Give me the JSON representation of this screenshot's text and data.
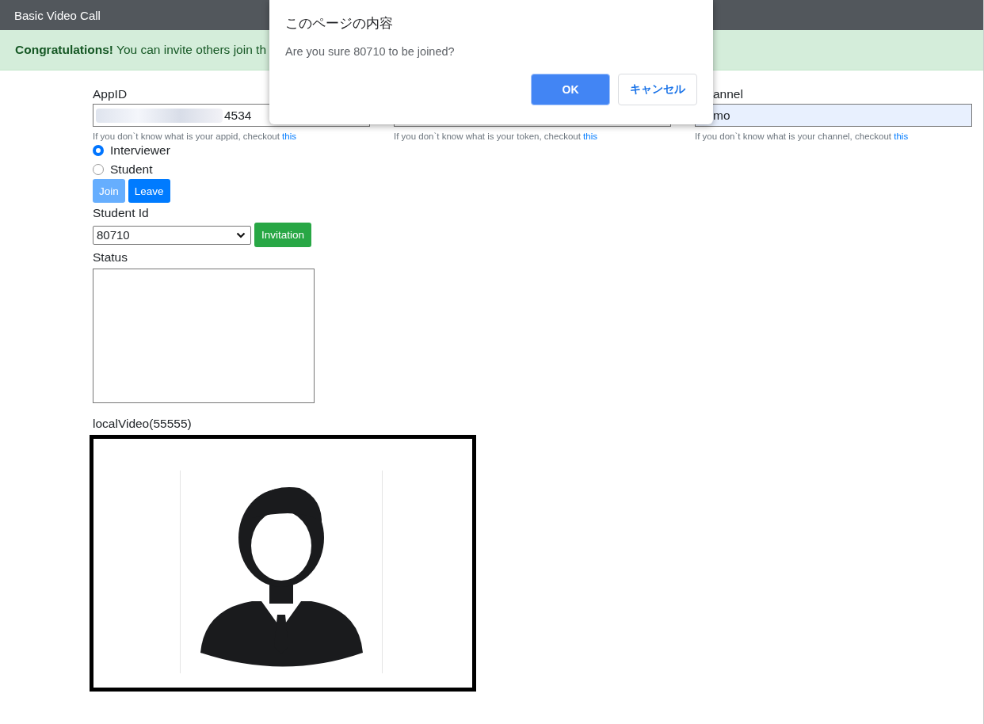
{
  "navbar": {
    "title": "Basic Video Call"
  },
  "alert": {
    "text": "**Congratulations!** You can invite others join th"
  },
  "fields": [
    {
      "label": "AppID",
      "value": "4534",
      "blurred": true,
      "hint": "If you don`t know what is your appid, checkout",
      "link": "this"
    },
    {
      "hint": "If you don`t know what is your token, checkout",
      "link": "this"
    },
    {
      "label": "annel",
      "value": "mo",
      "autofilled": true,
      "hint": "If you don`t know what is your channel, checkout",
      "link": "this"
    }
  ],
  "roles": [
    {
      "label": "Interviewer",
      "selected": true
    },
    {
      "label": "Student",
      "selected": false
    }
  ],
  "buttons": [
    {
      "label": "Join",
      "disabled": true
    },
    {
      "label": "Leave",
      "disabled": false
    }
  ],
  "student_id": {
    "label": "Student Id",
    "value": "80710",
    "button": "Invitation"
  },
  "status": {
    "label": "Status"
  },
  "local_video": {
    "title": "localVideo(55555)",
    "kind": "picture"
  },
  "dialog": {
    "title": "このページの内容",
    "message": "Are you sure 80710 to be joined?",
    "buttons": [
      {
        "label": "OK",
        "primary": true
      },
      {
        "label": "キャンセル",
        "primary": false
      }
    ]
  }
}
